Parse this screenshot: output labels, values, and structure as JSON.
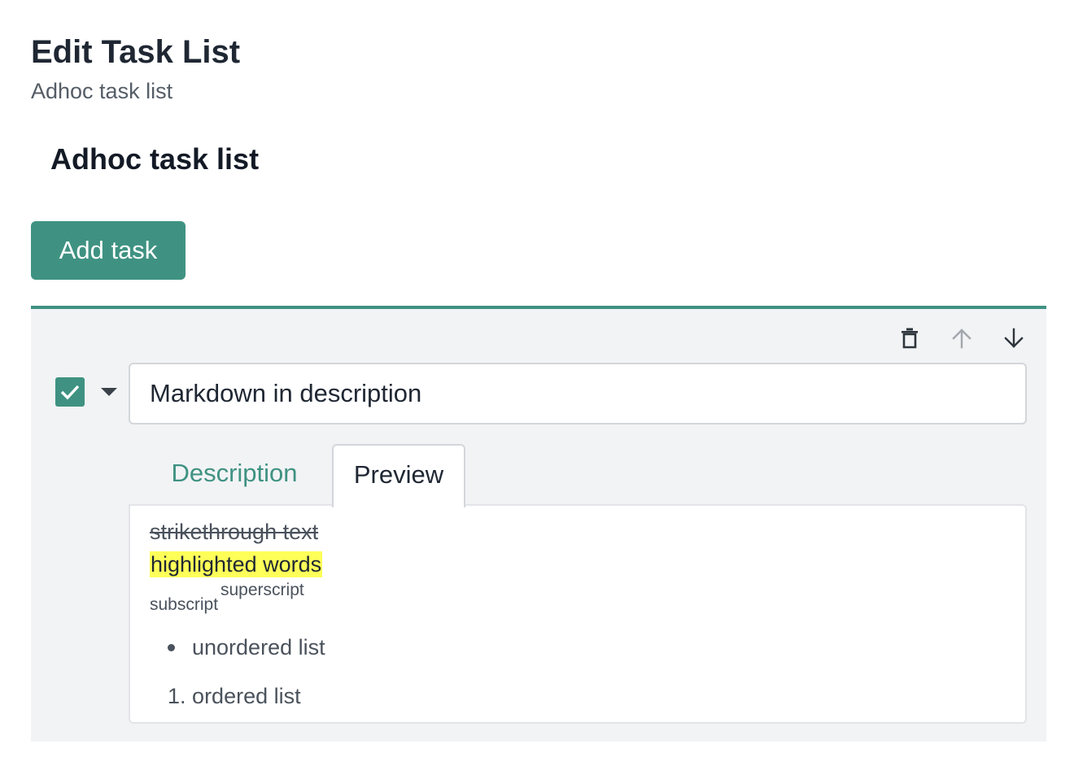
{
  "header": {
    "title": "Edit Task List",
    "subtitle": "Adhoc task list"
  },
  "task_list": {
    "name": "Adhoc task list",
    "add_task_label": "Add task"
  },
  "task": {
    "completed": true,
    "title_value": "Markdown in description",
    "actions": {
      "delete_icon": "trash-icon",
      "move_up_icon": "arrow-up-icon",
      "move_down_icon": "arrow-down-icon"
    },
    "tabs": [
      {
        "label": "Description",
        "active": false
      },
      {
        "label": "Preview",
        "active": true
      }
    ],
    "preview": {
      "strikethrough": "strikethrough text",
      "highlighted": "highlighted words",
      "subscript": "subscript",
      "superscript": "superscript",
      "unordered_item": "unordered list",
      "ordered_number": "1.",
      "ordered_item": "ordered list"
    }
  },
  "colors": {
    "accent": "#3f9282",
    "panel_bg": "#f2f3f5",
    "highlight": "#ffff59"
  }
}
